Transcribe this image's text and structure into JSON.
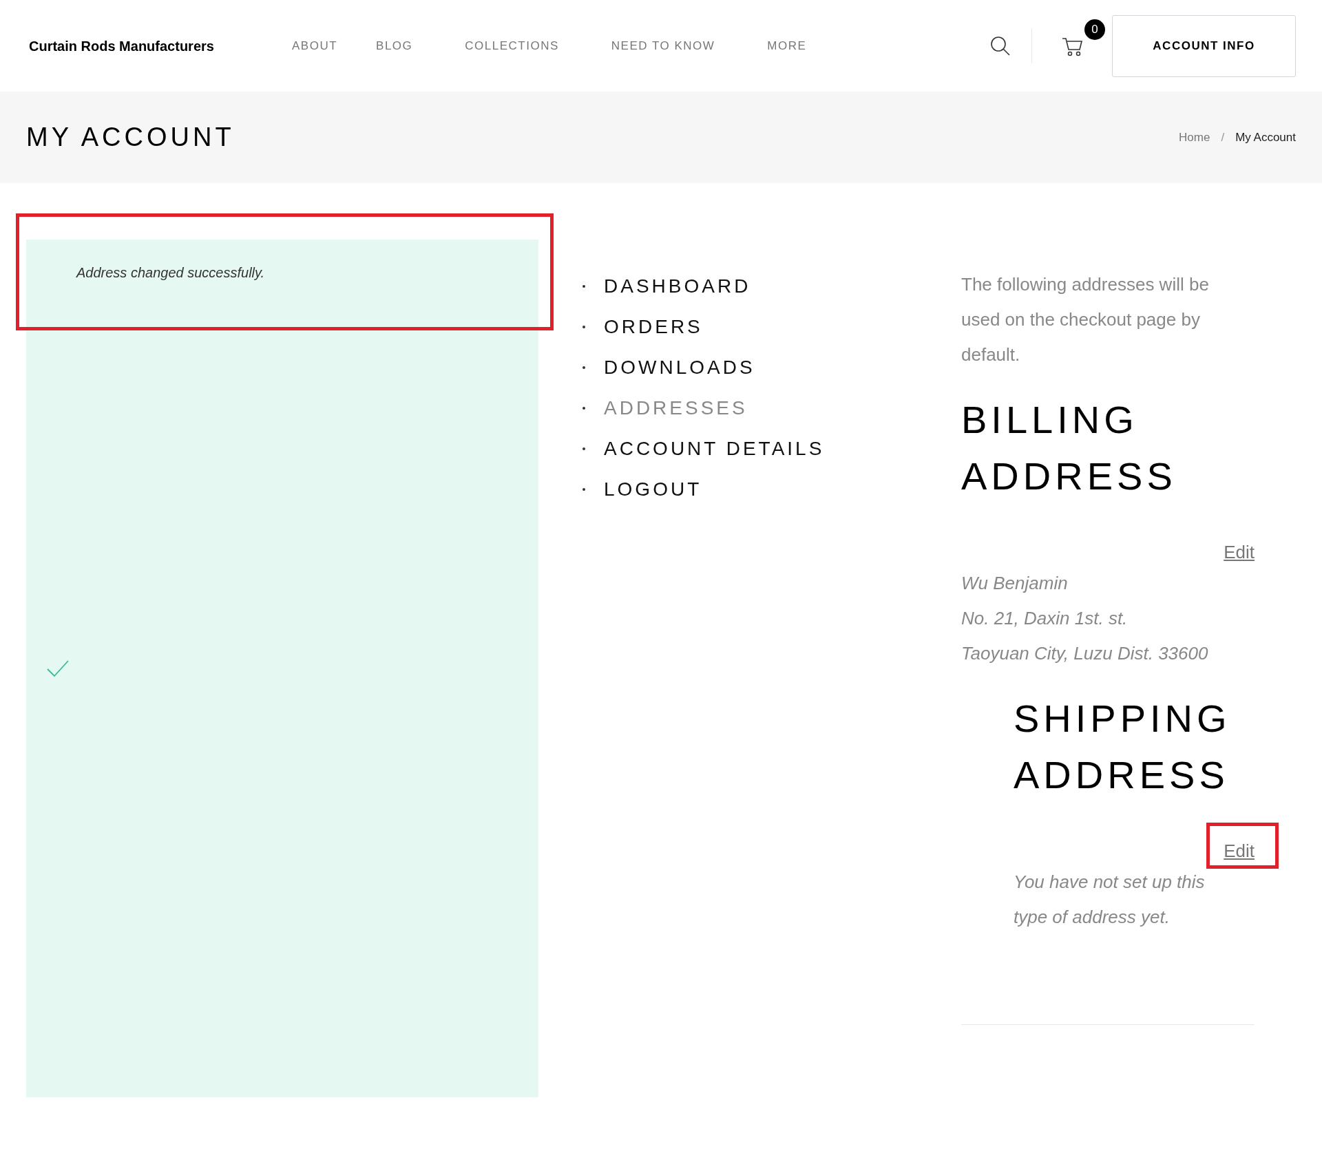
{
  "header": {
    "logo": "Curtain Rods Manufacturers",
    "nav": [
      "ABOUT",
      "BLOG",
      "COLLECTIONS",
      "NEED TO KNOW",
      "MORE"
    ],
    "cart_count": "0",
    "account_button": "ACCOUNT INFO"
  },
  "page_title": {
    "title": "MY ACCOUNT",
    "breadcrumb": [
      {
        "label": "Home",
        "current": false
      },
      {
        "label": "My Account",
        "current": true
      }
    ],
    "breadcrumb_separator": "/"
  },
  "notice": {
    "message": "Address changed successfully.",
    "highlighted": true
  },
  "account_menu": [
    {
      "label": "DASHBOARD",
      "selected": false
    },
    {
      "label": "ORDERS",
      "selected": false
    },
    {
      "label": "DOWNLOADS",
      "selected": false
    },
    {
      "label": "ADDRESSES",
      "selected": true
    },
    {
      "label": "ACCOUNT DETAILS",
      "selected": false
    },
    {
      "label": "LOGOUT",
      "selected": false
    }
  ],
  "intro": "The following addresses will be used on the checkout page by default.",
  "addresses": [
    {
      "heading": "BILLING ADDRESS",
      "edit_link": {
        "label": "Edit",
        "highlighted": false
      },
      "lines": [
        "Wu Benjamin",
        "No. 21, Daxin 1st. st.",
        "Taoyuan City, Luzu Dist. 33600"
      ]
    },
    {
      "heading": "SHIPPING ADDRESS",
      "edit_link": {
        "label": "Edit",
        "highlighted": true
      },
      "lines": [
        "You have not set up this",
        "type of address yet."
      ]
    }
  ]
}
